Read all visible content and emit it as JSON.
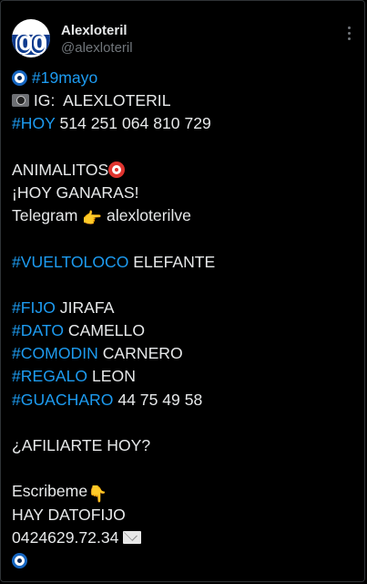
{
  "author": {
    "display_name": "Alexloteril",
    "handle": "@alexloteril",
    "avatar_text": "000"
  },
  "post": {
    "line1_tag": "#19mayo",
    "line2_text": " IG:  ALEXLOTERIL",
    "line3_tag": "#HOY",
    "line3_text": " 514 251 064 810 729",
    "line5_text": "ANIMALITOS",
    "line6_text": "¡HOY GANARAS!",
    "line7_text_a": "Telegram ",
    "line7_text_b": " alexloterilve",
    "line9_tag": "#VUELTOLOCO",
    "line9_text": " ELEFANTE",
    "line11_tag": "#FIJO",
    "line11_text": " JIRAFA",
    "line12_tag": "#DATO",
    "line12_text": " CAMELLO",
    "line13_tag": "#COMODIN",
    "line13_text": " CARNERO",
    "line14_tag": "#REGALO",
    "line14_text": " LEON",
    "line15_tag": "#GUACHARO",
    "line15_text": " 44 75 49 58",
    "line17_text": "¿AFILIARTE HOY?",
    "line19_text": "Escribeme",
    "line20_text": "HAY DATOFIJO",
    "line21_text": "0424629.72.34 ",
    "pointing_emoji": "👉",
    "pointing_down_emoji": "👇"
  },
  "colors": {
    "background": "#000000",
    "text": "#e7e9ea",
    "hashtag": "#1d9bf0",
    "secondary": "#71767b"
  },
  "icons": [
    "nazar-amulet-icon",
    "camera-icon",
    "target-icon",
    "pointing-hand-icon",
    "pointing-down-icon",
    "envelope-icon",
    "more-options-icon"
  ]
}
